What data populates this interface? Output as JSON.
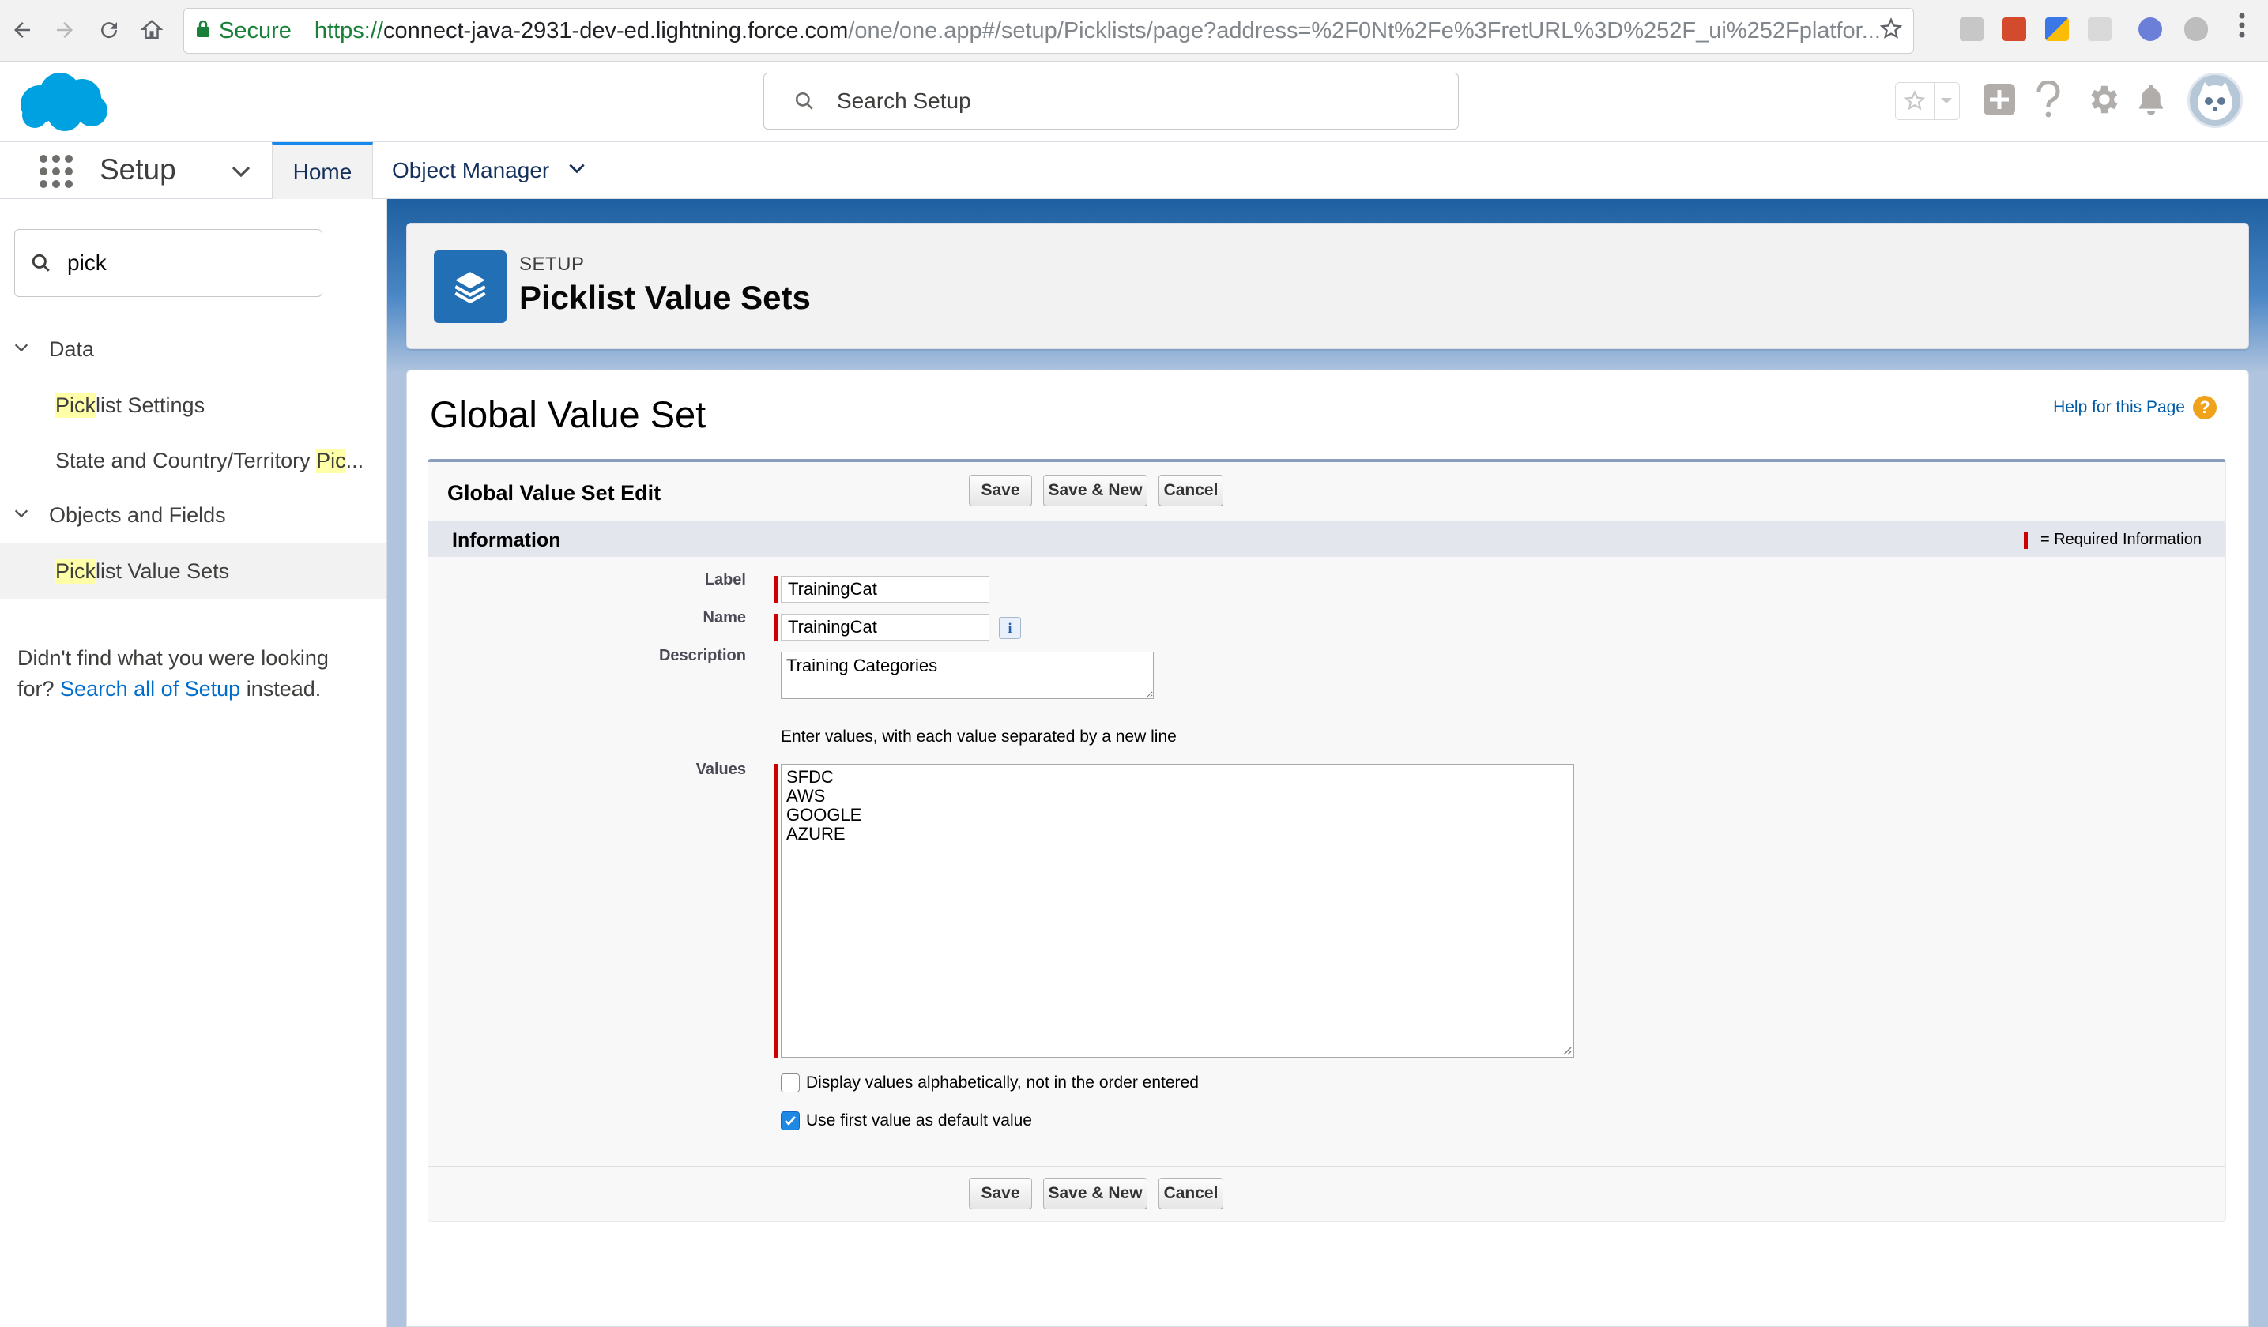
{
  "browser": {
    "secure_label": "Secure",
    "url_scheme": "https://",
    "url_host": "connect-java-2931-dev-ed.lightning.force.com",
    "url_path": "/one/one.app#/setup/Picklists/page?address=%2F0Nt%2Fe%3FretURL%3D%252F_ui%252Fplatfor..."
  },
  "header": {
    "search_placeholder": "Search Setup"
  },
  "context_bar": {
    "app_name": "Setup",
    "tabs": [
      {
        "label": "Home"
      },
      {
        "label": "Object Manager"
      }
    ]
  },
  "sidebar": {
    "quickfind_value": "pick",
    "sections": [
      {
        "label": "Data",
        "items": [
          {
            "highlight": "Pick",
            "rest": "list Settings"
          },
          {
            "pre": "State and Country/Territory ",
            "highlight": "Pic",
            "rest": "..."
          }
        ]
      },
      {
        "label": "Objects and Fields",
        "items": [
          {
            "highlight": "Pick",
            "rest": "list Value Sets"
          }
        ]
      }
    ],
    "not_found_prefix": "Didn't find what you were looking for?",
    "not_found_link": "Search all of Setup",
    "not_found_suffix": "instead."
  },
  "page_header": {
    "eyebrow": "SETUP",
    "title": "Picklist Value Sets"
  },
  "content": {
    "title": "Global Value Set",
    "help_link": "Help for this Page",
    "help_icon_glyph": "?",
    "block_title": "Global Value Set Edit",
    "buttons": {
      "save": "Save",
      "save_new": "Save & New",
      "cancel": "Cancel"
    },
    "section_title": "Information",
    "required_legend": "= Required Information",
    "fields": {
      "label": {
        "label": "Label",
        "value": "TrainingCat"
      },
      "name": {
        "label": "Name",
        "value": "TrainingCat",
        "info_glyph": "i"
      },
      "description": {
        "label": "Description",
        "value": "Training Categories"
      },
      "values": {
        "label": "Values",
        "help": "Enter values, with each value separated by a new line",
        "items": [
          "SFDC",
          "AWS",
          "GOOGLE",
          "AZURE"
        ]
      }
    },
    "checkboxes": [
      {
        "label": "Display values alphabetically, not in the order entered",
        "checked": false
      },
      {
        "label": "Use first value as default value",
        "checked": true
      }
    ]
  },
  "colors": {
    "brand_blue": "#00a1e0",
    "link_blue": "#006dcc",
    "required_red": "#cc0000",
    "highlight_yellow": "#ffffa8"
  },
  "icons": [
    "back-icon",
    "forward-icon",
    "reload-icon",
    "home-icon",
    "lock-icon",
    "bookmark-star-icon",
    "search-icon",
    "favorites-star-icon",
    "add-icon",
    "help-icon",
    "gear-icon",
    "bell-icon",
    "waffle-icon",
    "chevron-down-icon",
    "stack-icon",
    "info-icon"
  ]
}
